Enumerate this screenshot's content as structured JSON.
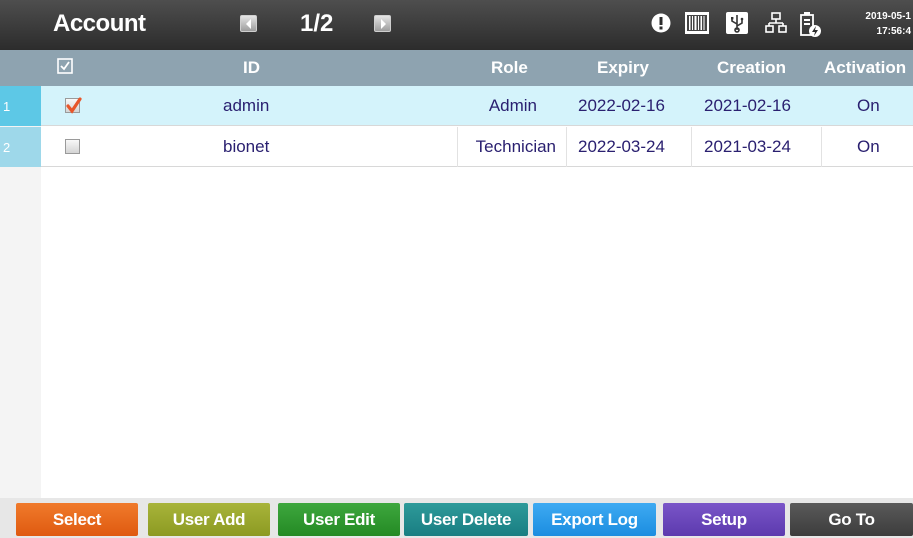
{
  "header": {
    "title": "Account",
    "page_indicator": "1/2",
    "date": "2019-05-1",
    "time": "17:56:4",
    "icons": [
      "chevron-left-icon",
      "chevron-right-icon",
      "alert-icon",
      "barcode-icon",
      "usb-icon",
      "network-icon",
      "battery-charging-icon"
    ]
  },
  "table": {
    "columns": [
      "ID",
      "Role",
      "Expiry",
      "Creation",
      "Activation"
    ],
    "rows": [
      {
        "index": "1",
        "checked": true,
        "id": "admin",
        "role": "Admin",
        "expiry": "2022-02-16",
        "creation": "2021-02-16",
        "activation": "On"
      },
      {
        "index": "2",
        "checked": false,
        "id": "bionet",
        "role": "Technician",
        "expiry": "2022-03-24",
        "creation": "2021-03-24",
        "activation": "On"
      }
    ]
  },
  "footer": {
    "buttons": [
      "Select",
      "User Add",
      "User Edit",
      "User Delete",
      "Export Log",
      "Setup",
      "Go To"
    ]
  },
  "colors": {
    "header_bg": "#3a3a3a",
    "column_header_bg": "#8ea3b0",
    "selected_row_bg": "#d4f3fb",
    "row_text": "#2a2070",
    "check_mark": "#e8562a"
  }
}
